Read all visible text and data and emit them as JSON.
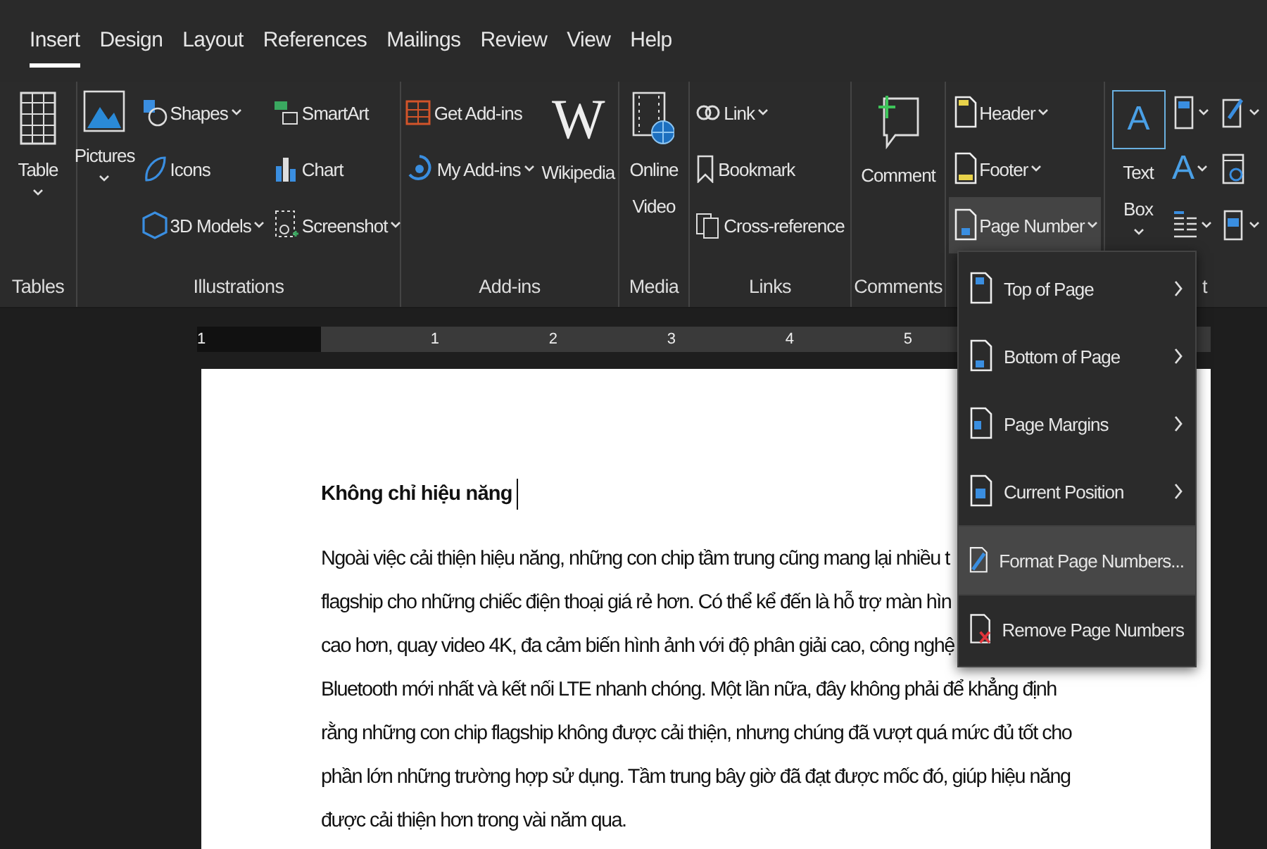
{
  "tabs": [
    {
      "label": "Insert",
      "selected": true
    },
    {
      "label": "Design",
      "selected": false
    },
    {
      "label": "Layout",
      "selected": false
    },
    {
      "label": "References",
      "selected": false
    },
    {
      "label": "Mailings",
      "selected": false
    },
    {
      "label": "Review",
      "selected": false
    },
    {
      "label": "View",
      "selected": false
    },
    {
      "label": "Help",
      "selected": false
    }
  ],
  "ribbon": {
    "groups": [
      {
        "label": "Tables",
        "columns": [
          {
            "kind": "large",
            "label": "Table",
            "menu": true
          }
        ]
      },
      {
        "label": "Illustrations",
        "columns": [
          {
            "kind": "large",
            "label": "Pictures",
            "menu": true
          },
          {
            "kind": "stack",
            "items": [
              {
                "label": "Shapes",
                "menu": true
              },
              {
                "label": "Icons",
                "menu": false
              },
              {
                "label": "3D Models",
                "menu": true
              }
            ]
          },
          {
            "kind": "stack",
            "items": [
              {
                "label": "SmartArt",
                "menu": false
              },
              {
                "label": "Chart",
                "menu": false
              },
              {
                "label": "Screenshot",
                "menu": true
              }
            ]
          }
        ]
      },
      {
        "label": "Add-ins",
        "columns": [
          {
            "kind": "stack",
            "items": [
              {
                "label": "Get Add-ins",
                "menu": false
              },
              {
                "label": "My Add-ins",
                "menu": true
              }
            ]
          },
          {
            "kind": "large",
            "label": "Wikipedia",
            "glyph": "W",
            "menu": false
          }
        ]
      },
      {
        "label": "Media",
        "columns": [
          {
            "kind": "large",
            "label": "Online Video",
            "menu": false
          }
        ]
      },
      {
        "label": "Links",
        "columns": [
          {
            "kind": "stack",
            "items": [
              {
                "label": "Link",
                "menu": true
              },
              {
                "label": "Bookmark",
                "menu": false
              },
              {
                "label": "Cross-reference",
                "menu": false
              }
            ]
          }
        ]
      },
      {
        "label": "Comments",
        "columns": [
          {
            "kind": "large",
            "label": "Comment",
            "menu": false
          }
        ]
      },
      {
        "columns": [
          {
            "kind": "stack",
            "items": [
              {
                "label": "Header",
                "menu": true,
                "open": false
              },
              {
                "label": "Footer",
                "menu": true,
                "open": false
              },
              {
                "label": "Page Number",
                "menu": true,
                "open": true
              }
            ]
          }
        ]
      },
      {
        "label": "t",
        "columns": [
          {
            "kind": "large",
            "label": "Text Box",
            "glyph": "A",
            "menu": true
          },
          {
            "kind": "stack",
            "items": [
              {
                "menu": true
              },
              {
                "glyph": "A",
                "menu": true
              },
              {
                "menu": true
              }
            ]
          },
          {
            "kind": "stack",
            "items": [
              {
                "menu": true
              },
              {
                "menu": false
              },
              {
                "menu": true
              }
            ]
          }
        ]
      }
    ]
  },
  "ruler": {
    "labels": [
      "1",
      "1",
      "2",
      "3",
      "4",
      "5"
    ]
  },
  "document": {
    "heading": "Không chỉ hiệu năng",
    "lines": [
      "Ngoài việc cải thiện hiệu năng, những con chip tầm trung cũng mang lại nhiều t",
      "flagship cho những chiếc điện thoại giá rẻ hơn. Có thể kể đến là hỗ trợ màn hìn",
      "cao hơn, quay video 4K, đa cảm biến hình ảnh với độ phân giải cao, công nghệ",
      "Bluetooth mới nhất và kết nối LTE nhanh chóng. Một lần nữa, đây không phải để khẳng định",
      "rằng những con chip flagship không được cải thiện, nhưng chúng đã vượt quá mức đủ tốt cho",
      "phần lớn những trường hợp sử dụng. Tầm trung bây giờ đã đạt được mốc đó, giúp hiệu năng",
      "được cải thiện hơn trong vài năm qua."
    ]
  },
  "menu": {
    "sections": [
      [
        {
          "label": "Top of Page",
          "submenu": true,
          "highlighted": false
        },
        {
          "label": "Bottom of Page",
          "submenu": true,
          "highlighted": false
        },
        {
          "label": "Page Margins",
          "submenu": true,
          "highlighted": false
        },
        {
          "label": "Current Position",
          "submenu": true,
          "highlighted": false
        }
      ],
      [
        {
          "label": "Format Page Numbers...",
          "submenu": false,
          "highlighted": true
        }
      ],
      [
        {
          "label": "Remove Page Numbers",
          "submenu": false,
          "highlighted": false
        }
      ]
    ]
  }
}
